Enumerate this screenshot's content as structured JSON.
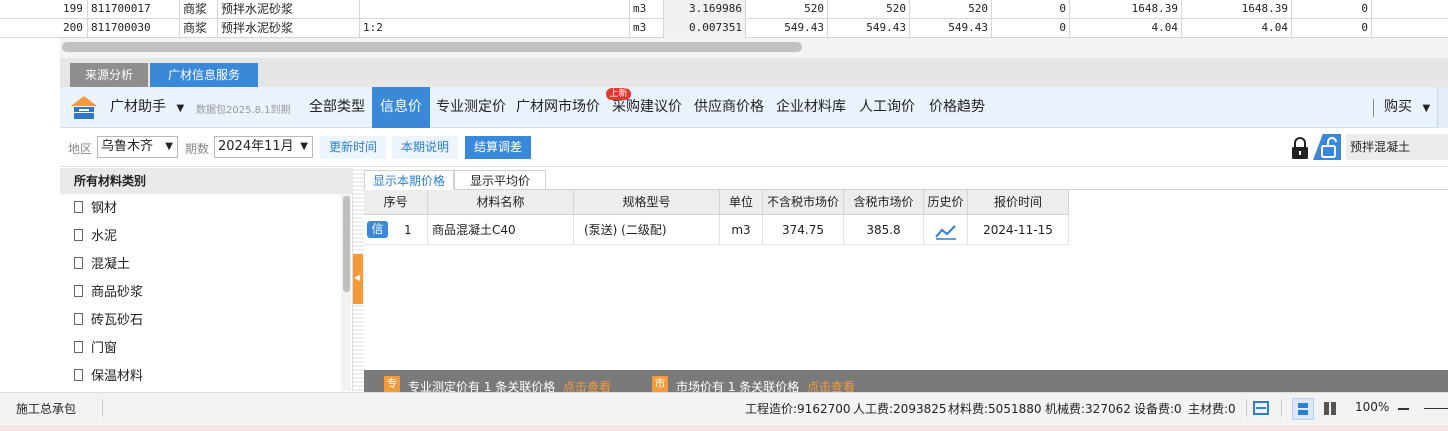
{
  "top_table": {
    "rows": [
      {
        "no": "199",
        "code": "811700017",
        "type": "商浆",
        "name": "预拌水泥砂浆",
        "spec": "",
        "unit": "m3",
        "qty": "3.169986",
        "p1": "520",
        "p2": "520",
        "p3": "520",
        "z": "0",
        "t1": "1648.39",
        "t2": "1648.39",
        "z2": "0"
      },
      {
        "no": "200",
        "code": "811700030",
        "type": "商浆",
        "name": "预拌水泥砂浆",
        "spec": "1:2",
        "unit": "m3",
        "qty": "0.007351",
        "p1": "549.43",
        "p2": "549.43",
        "p3": "549.43",
        "z": "0",
        "t1": "4.04",
        "t2": "4.04",
        "z2": "0"
      }
    ]
  },
  "panel_tabs": [
    "来源分析",
    "广材信息服务"
  ],
  "navbar": {
    "assistant": "广材助手",
    "data_pack": "数据包2025.8.1到期",
    "items": [
      "全部类型",
      "信息价",
      "专业测定价",
      "广材网市场价",
      "采购建议价",
      "供应商价格",
      "企业材料库",
      "人工询价",
      "价格趋势"
    ],
    "new_badge": "上新",
    "buy": "购买"
  },
  "filter": {
    "region_label": "地区",
    "region_value": "乌鲁木齐",
    "period_label": "期数",
    "period_value": "2024年11月",
    "btn_update": "更新时间",
    "btn_note": "本期说明",
    "btn_settle": "结算调差",
    "search_value": "预拌混凝土"
  },
  "sidebar": {
    "title": "所有材料类别",
    "categories": [
      "钢材",
      "水泥",
      "混凝土",
      "商品砂浆",
      "砖瓦砂石",
      "门窗",
      "保温材料"
    ]
  },
  "price_tabs": [
    "显示本期价格",
    "显示平均价"
  ],
  "grid": {
    "headers": [
      "序号",
      "材料名称",
      "规格型号",
      "单位",
      "不含税市场价",
      "含税市场价",
      "历史价",
      "报价时间"
    ],
    "rows": [
      {
        "tag": "信",
        "no": "1",
        "name": "商品混凝土C40",
        "spec": "(泵送)  (二级配)",
        "unit": "m3",
        "price_ex": "374.75",
        "price_in": "385.8",
        "date": "2024-11-15"
      }
    ]
  },
  "infobar": {
    "icon1": "专",
    "text1": "专业测定价有 1 条关联价格",
    "link1": "点击查看",
    "icon2": "市",
    "text2": "市场价有 1 条关联价格",
    "link2": "点击查看"
  },
  "statusbar": {
    "left": "施工总承包",
    "cost": "工程造价:9162700",
    "labor": "人工费:2093825",
    "material": "材料费:5051880",
    "machine": "机械费:327062",
    "equipment": "设备费:0",
    "main_material": "主材费:0",
    "zoom": "100%"
  },
  "colors": {
    "accent": "#3a88d8",
    "orange": "#f39b3a",
    "tab_dark": "#8e8e8e"
  },
  "icons": [
    "logo-icon",
    "lock-icon",
    "unlock-icon",
    "chart-line-icon",
    "document-icon",
    "chevron-down-icon",
    "layout-icon",
    "minus-icon"
  ]
}
